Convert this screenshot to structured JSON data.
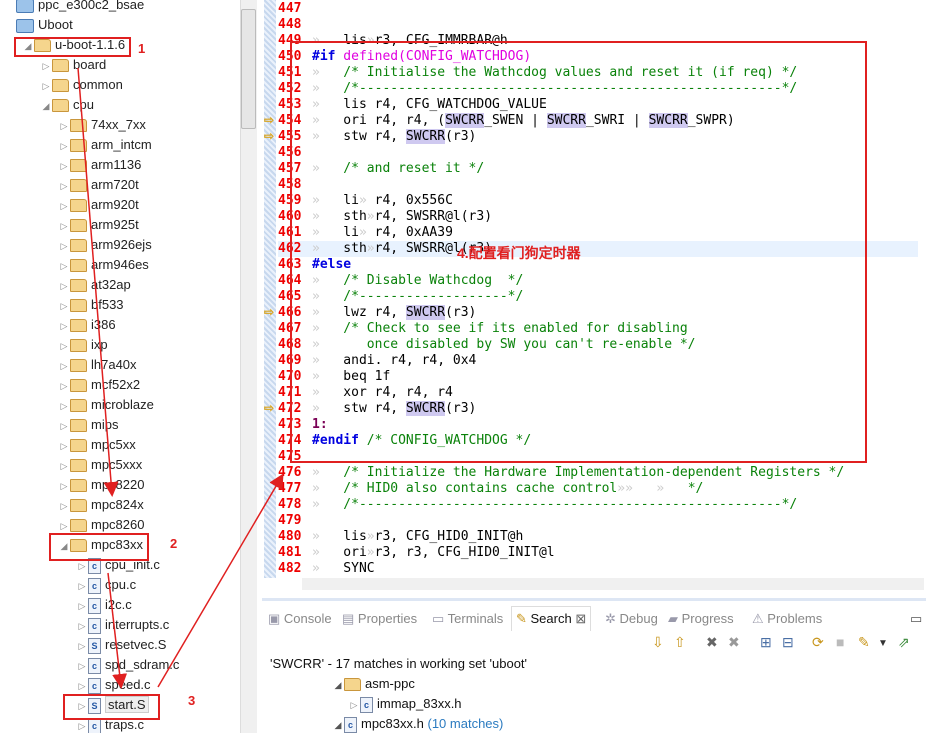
{
  "tree": [
    {
      "label": "ppc_e300c2_bsae",
      "indent": 0,
      "type": "proj",
      "tw": ""
    },
    {
      "label": "Uboot",
      "indent": 0,
      "type": "proj",
      "tw": ""
    },
    {
      "label": "u-boot-1.1.6",
      "indent": 1,
      "type": "folder",
      "tw": "◢"
    },
    {
      "label": "board",
      "indent": 2,
      "type": "folder",
      "tw": "▷"
    },
    {
      "label": "common",
      "indent": 2,
      "type": "folder",
      "tw": "▷"
    },
    {
      "label": "cpu",
      "indent": 2,
      "type": "folder",
      "tw": "◢"
    },
    {
      "label": "74xx_7xx",
      "indent": 3,
      "type": "folder",
      "tw": "▷"
    },
    {
      "label": "arm_intcm",
      "indent": 3,
      "type": "folder",
      "tw": "▷"
    },
    {
      "label": "arm1136",
      "indent": 3,
      "type": "folder",
      "tw": "▷"
    },
    {
      "label": "arm720t",
      "indent": 3,
      "type": "folder",
      "tw": "▷"
    },
    {
      "label": "arm920t",
      "indent": 3,
      "type": "folder",
      "tw": "▷"
    },
    {
      "label": "arm925t",
      "indent": 3,
      "type": "folder",
      "tw": "▷"
    },
    {
      "label": "arm926ejs",
      "indent": 3,
      "type": "folder",
      "tw": "▷"
    },
    {
      "label": "arm946es",
      "indent": 3,
      "type": "folder",
      "tw": "▷"
    },
    {
      "label": "at32ap",
      "indent": 3,
      "type": "folder",
      "tw": "▷"
    },
    {
      "label": "bf533",
      "indent": 3,
      "type": "folder",
      "tw": "▷"
    },
    {
      "label": "i386",
      "indent": 3,
      "type": "folder",
      "tw": "▷"
    },
    {
      "label": "ixp",
      "indent": 3,
      "type": "folder",
      "tw": "▷"
    },
    {
      "label": "lh7a40x",
      "indent": 3,
      "type": "folder",
      "tw": "▷"
    },
    {
      "label": "mcf52x2",
      "indent": 3,
      "type": "folder",
      "tw": "▷"
    },
    {
      "label": "microblaze",
      "indent": 3,
      "type": "folder",
      "tw": "▷"
    },
    {
      "label": "mips",
      "indent": 3,
      "type": "folder",
      "tw": "▷"
    },
    {
      "label": "mpc5xx",
      "indent": 3,
      "type": "folder",
      "tw": "▷"
    },
    {
      "label": "mpc5xxx",
      "indent": 3,
      "type": "folder",
      "tw": "▷"
    },
    {
      "label": "mpc8220",
      "indent": 3,
      "type": "folder",
      "tw": "▷"
    },
    {
      "label": "mpc824x",
      "indent": 3,
      "type": "folder",
      "tw": "▷"
    },
    {
      "label": "mpc8260",
      "indent": 3,
      "type": "folder",
      "tw": "▷"
    },
    {
      "label": "mpc83xx",
      "indent": 3,
      "type": "folder",
      "tw": "◢"
    },
    {
      "label": "cpu_init.c",
      "indent": 4,
      "type": "c",
      "tw": "▷"
    },
    {
      "label": "cpu.c",
      "indent": 4,
      "type": "c",
      "tw": "▷"
    },
    {
      "label": "i2c.c",
      "indent": 4,
      "type": "c",
      "tw": "▷"
    },
    {
      "label": "interrupts.c",
      "indent": 4,
      "type": "c",
      "tw": "▷"
    },
    {
      "label": "resetvec.S",
      "indent": 4,
      "type": "s",
      "tw": "▷"
    },
    {
      "label": "spd_sdram.c",
      "indent": 4,
      "type": "c",
      "tw": "▷"
    },
    {
      "label": "speed.c",
      "indent": 4,
      "type": "c",
      "tw": "▷"
    },
    {
      "label": "start.S",
      "indent": 4,
      "type": "s",
      "tw": "▷"
    },
    {
      "label": "traps.c",
      "indent": 4,
      "type": "c",
      "tw": "▷"
    }
  ],
  "code": [
    {
      "n": "447",
      "s": []
    },
    {
      "n": "448",
      "s": []
    },
    {
      "n": "449",
      "s": [
        [
          "»",
          "ws"
        ],
        [
          "   lis",
          ""
        ],
        [
          "»",
          "ws"
        ],
        [
          "r3, CFG_IMMRBAR@h",
          ""
        ]
      ]
    },
    {
      "n": "450",
      "s": [
        [
          "#if",
          "kw"
        ],
        [
          " defined(CONFIG_WATCHDOG)",
          "mac"
        ]
      ]
    },
    {
      "n": "451",
      "s": [
        [
          "»",
          "ws"
        ],
        [
          "   /* Initialise the Wathcdog values and reset it (if req) */",
          "cm"
        ]
      ]
    },
    {
      "n": "452",
      "s": [
        [
          "»",
          "ws"
        ],
        [
          "   /*------------------------------------------------------*/",
          "cm"
        ]
      ]
    },
    {
      "n": "453",
      "s": [
        [
          "»",
          "ws"
        ],
        [
          "   lis r4, CFG_WATCHDOG_VALUE",
          ""
        ]
      ]
    },
    {
      "n": "454",
      "m": true,
      "s": [
        [
          "»",
          "ws"
        ],
        [
          "   ori r4, r4, (",
          ""
        ],
        [
          "SWCRR",
          "hl"
        ],
        [
          "_SWEN | ",
          ""
        ],
        [
          "SWCRR",
          "hl"
        ],
        [
          "_SWRI | ",
          ""
        ],
        [
          "SWCRR",
          "hl"
        ],
        [
          "_SWPR)",
          ""
        ]
      ]
    },
    {
      "n": "455",
      "m": true,
      "s": [
        [
          "»",
          "ws"
        ],
        [
          "   stw r4, ",
          ""
        ],
        [
          "SWCRR",
          "hl"
        ],
        [
          "(r3)",
          ""
        ]
      ]
    },
    {
      "n": "456",
      "s": []
    },
    {
      "n": "457",
      "s": [
        [
          "»",
          "ws"
        ],
        [
          "   /* and reset it */",
          "cm"
        ]
      ]
    },
    {
      "n": "458",
      "s": []
    },
    {
      "n": "459",
      "s": [
        [
          "»",
          "ws"
        ],
        [
          "   li",
          ""
        ],
        [
          "»",
          "ws"
        ],
        [
          " r4, 0x556C",
          ""
        ]
      ]
    },
    {
      "n": "460",
      "s": [
        [
          "»",
          "ws"
        ],
        [
          "   sth",
          ""
        ],
        [
          "»",
          "ws"
        ],
        [
          "r4, SWSRR@l(r3)",
          ""
        ]
      ]
    },
    {
      "n": "461",
      "s": [
        [
          "»",
          "ws"
        ],
        [
          "   li",
          ""
        ],
        [
          "»",
          "ws"
        ],
        [
          " r4, 0xAA39",
          ""
        ]
      ]
    },
    {
      "n": "462",
      "cur": true,
      "s": [
        [
          "»",
          "ws"
        ],
        [
          "   sth",
          ""
        ],
        [
          "»",
          "ws"
        ],
        [
          "r4, SWSRR@l(r3)",
          ""
        ]
      ]
    },
    {
      "n": "463",
      "s": [
        [
          "#else",
          "kw"
        ]
      ]
    },
    {
      "n": "464",
      "s": [
        [
          "»",
          "ws"
        ],
        [
          "   /* Disable Wathcdog  */",
          "cm"
        ]
      ]
    },
    {
      "n": "465",
      "s": [
        [
          "»",
          "ws"
        ],
        [
          "   /*-------------------*/",
          "cm"
        ]
      ]
    },
    {
      "n": "466",
      "m": true,
      "s": [
        [
          "»",
          "ws"
        ],
        [
          "   lwz r4, ",
          ""
        ],
        [
          "SWCRR",
          "hl"
        ],
        [
          "(r3)",
          ""
        ]
      ]
    },
    {
      "n": "467",
      "s": [
        [
          "»",
          "ws"
        ],
        [
          "   /* Check to see if its enabled for disabling",
          "cm"
        ]
      ]
    },
    {
      "n": "468",
      "s": [
        [
          "»",
          "ws"
        ],
        [
          "      once disabled by SW you can't re-enable */",
          "cm"
        ]
      ]
    },
    {
      "n": "469",
      "s": [
        [
          "»",
          "ws"
        ],
        [
          "   andi. r4, r4, 0x4",
          ""
        ]
      ]
    },
    {
      "n": "470",
      "s": [
        [
          "»",
          "ws"
        ],
        [
          "   beq 1f",
          ""
        ]
      ]
    },
    {
      "n": "471",
      "s": [
        [
          "»",
          "ws"
        ],
        [
          "   xor r4, r4, r4",
          ""
        ]
      ]
    },
    {
      "n": "472",
      "m": true,
      "s": [
        [
          "»",
          "ws"
        ],
        [
          "   stw r4, ",
          ""
        ],
        [
          "SWCRR",
          "hl"
        ],
        [
          "(r3)",
          ""
        ]
      ]
    },
    {
      "n": "473",
      "s": [
        [
          "1:",
          "lbl"
        ]
      ]
    },
    {
      "n": "474",
      "s": [
        [
          "#endif",
          "kw"
        ],
        [
          " /* CONFIG_WATCHDOG */",
          "cm"
        ]
      ]
    },
    {
      "n": "475",
      "s": []
    },
    {
      "n": "476",
      "s": [
        [
          "»",
          "ws"
        ],
        [
          "   /* Initialize the Hardware Implementation-dependent Registers */",
          "cm"
        ]
      ]
    },
    {
      "n": "477",
      "s": [
        [
          "»",
          "ws"
        ],
        [
          "   /* HID0 also contains cache control",
          "cm"
        ],
        [
          "»»   »",
          "ws"
        ],
        [
          "   */",
          "cm"
        ]
      ]
    },
    {
      "n": "478",
      "s": [
        [
          "»",
          "ws"
        ],
        [
          "   /*------------------------------------------------------*/",
          "cm"
        ]
      ]
    },
    {
      "n": "479",
      "s": []
    },
    {
      "n": "480",
      "s": [
        [
          "»",
          "ws"
        ],
        [
          "   lis",
          ""
        ],
        [
          "»",
          "ws"
        ],
        [
          "r3, CFG_HID0_INIT@h",
          ""
        ]
      ]
    },
    {
      "n": "481",
      "s": [
        [
          "»",
          "ws"
        ],
        [
          "   ori",
          ""
        ],
        [
          "»",
          "ws"
        ],
        [
          "r3, r3, CFG_HID0_INIT@l",
          ""
        ]
      ]
    },
    {
      "n": "482",
      "s": [
        [
          "»",
          "ws"
        ],
        [
          "   SYNC",
          ""
        ]
      ]
    }
  ],
  "panel": {
    "tabs": [
      {
        "label": "Console",
        "icon": "console-icon"
      },
      {
        "label": "Properties",
        "icon": "properties-icon"
      },
      {
        "label": "Terminals",
        "icon": "terminal-icon"
      },
      {
        "label": "Search",
        "icon": "search-icon",
        "active": true
      },
      {
        "label": "Debug",
        "icon": "debug-icon"
      },
      {
        "label": "Progress",
        "icon": "progress-icon"
      },
      {
        "label": "Problems",
        "icon": "problems-icon"
      }
    ],
    "status": "'SWCRR' - 17 matches in working set 'uboot'",
    "results": [
      {
        "label": "asm-ppc"
      },
      {
        "label": "immap_83xx.h"
      },
      {
        "label": "mpc83xx.h",
        "count": "(10 matches)"
      }
    ]
  },
  "annotations": {
    "a1": "1",
    "a2": "2",
    "a3": "3",
    "a4": "4.配置看门狗定时器",
    "color": "#e02020"
  }
}
